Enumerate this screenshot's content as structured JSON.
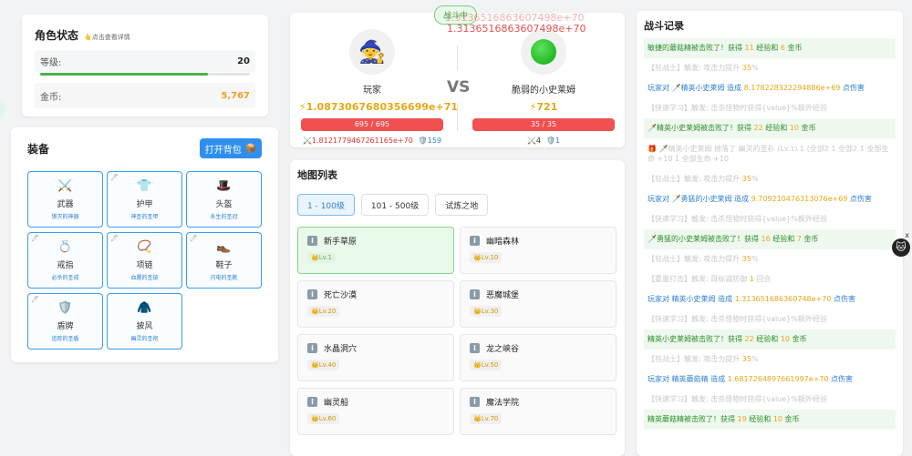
{
  "status": {
    "title": "角色状态",
    "hint": "👆点击查看详情",
    "level_label": "等级:",
    "level_value": "20",
    "level_progress": 0.8,
    "gold_label": "金币:",
    "gold_value": "5,767"
  },
  "equipment": {
    "title": "装备",
    "bag_button": "打开背包",
    "bag_icon": "📦",
    "slots": [
      {
        "icon": "⚔️",
        "name": "武器",
        "sub": "狼灭的神器",
        "edit": false
      },
      {
        "icon": "👕",
        "name": "护甲",
        "sub": "神圣的圣甲",
        "edit": true
      },
      {
        "icon": "🎩",
        "name": "头盔",
        "sub": "永生的圣冠",
        "edit": false
      },
      {
        "icon": "💍",
        "name": "戒指",
        "sub": "必杀的圣戒",
        "edit": true
      },
      {
        "icon": "📿",
        "name": "项链",
        "sub": "血腥的圣链",
        "edit": true
      },
      {
        "icon": "👞",
        "name": "鞋子",
        "sub": "闪电的圣靴",
        "edit": true
      },
      {
        "icon": "🛡️",
        "name": "盾牌",
        "sub": "追踪的圣盾",
        "edit": true
      },
      {
        "icon": "🧥",
        "name": "披风",
        "sub": "幽灵的圣袍",
        "edit": false
      }
    ]
  },
  "battle": {
    "tag": "战斗中",
    "floating_1": "1.3136516863607498e+70",
    "floating_2": "1.3136516863607498e+70",
    "vs": "VS",
    "player": {
      "name": "玩家",
      "avatar": "🧙",
      "power": "⚡1.0873067680356699e+71",
      "hp": "695 / 695",
      "atk": "⚔️1.8121779467261165e+70",
      "def": "🛡️159"
    },
    "enemy": {
      "name": "脆弱的小史莱姆",
      "power": "⚡721",
      "hp": "35 / 35",
      "atk": "⚔️4",
      "def": "🛡️1"
    }
  },
  "maps": {
    "title": "地图列表",
    "tabs": [
      "1 - 100级",
      "101 - 500级",
      "试炼之地"
    ],
    "items": [
      {
        "name": "新手草原",
        "level": "👑Lv.1"
      },
      {
        "name": "幽暗森林",
        "level": "👑Lv.10"
      },
      {
        "name": "死亡沙漠",
        "level": "👑Lv.20"
      },
      {
        "name": "恶魔城堡",
        "level": "👑Lv.30"
      },
      {
        "name": "水晶洞穴",
        "level": "👑Lv.40"
      },
      {
        "name": "龙之峡谷",
        "level": "👑Lv.50"
      },
      {
        "name": "幽灵船",
        "level": "👑Lv.60"
      },
      {
        "name": "魔法学院",
        "level": "👑Lv.70"
      }
    ]
  },
  "log": {
    "title": "战斗记录",
    "lines": [
      {
        "t": "g",
        "parts": [
          "敏捷的蘑菇精被击败了！获得 ",
          "11",
          " 经验和 ",
          "6",
          " 金币"
        ]
      },
      {
        "t": "f",
        "parts": [
          "【狂战士】触发: 攻击力提升 ",
          "35",
          "%"
        ]
      },
      {
        "t": "b",
        "parts": [
          "玩家对 🗡️精英小史莱姆 造成 ",
          "8.178228322294886e+69",
          " 点伤害"
        ]
      },
      {
        "t": "f",
        "parts": [
          "【快速学习】触发: 击杀怪物时获得{value}%额外经验"
        ]
      },
      {
        "t": "g",
        "parts": [
          "🗡️精英小史莱姆被击败了！获得 ",
          "22",
          " 经验和 ",
          "10",
          " 金币"
        ]
      },
      {
        "t": "f2",
        "text": "🎁 🗡️精英小史莱姆 掉落了 幽灵的圣衫 (Lv.1) 1 (全部2 1 全部2 1 全部生命 +10 1 全部生命 +10"
      },
      {
        "t": "f",
        "parts": [
          "【狂战士】触发: 攻击力提升 ",
          "35",
          "%"
        ]
      },
      {
        "t": "b",
        "parts": [
          "玩家对 🗡️勇猛的小史莱姆 造成 ",
          "9.709210476313076e+69",
          " 点伤害"
        ]
      },
      {
        "t": "f",
        "parts": [
          "【快速学习】触发: 击杀怪物时获得{value}%额外经验"
        ]
      },
      {
        "t": "g",
        "parts": [
          "🗡️勇猛的小史莱姆被击败了！获得 ",
          "16",
          " 经验和 ",
          "7",
          " 金币"
        ]
      },
      {
        "t": "f",
        "parts": [
          "【狂战士】触发: 攻击力提升 ",
          "35",
          "%"
        ]
      },
      {
        "t": "f",
        "parts": [
          "【重量打击】触发: 目标减防御 ",
          "1",
          " 回合"
        ]
      },
      {
        "t": "b",
        "parts": [
          "玩家对 精英小史莱姆 造成 ",
          "1.313651686360748e+70",
          " 点伤害"
        ]
      },
      {
        "t": "f",
        "parts": [
          "【快速学习】触发: 击杀怪物时获得{value}%额外经验"
        ]
      },
      {
        "t": "g",
        "parts": [
          "精英小史莱姆被击败了！获得 ",
          "22",
          " 经验和 ",
          "10",
          " 金币"
        ]
      },
      {
        "t": "f",
        "parts": [
          "【狂战士】触发: 攻击力提升 ",
          "35",
          "%"
        ]
      },
      {
        "t": "b",
        "parts": [
          "玩家对 精英蘑菇精 造成 ",
          "1.6817264897661997e+70",
          " 点伤害"
        ]
      },
      {
        "t": "f",
        "parts": [
          "【快速学习】触发: 击杀怪物时获得{value}%额外经验"
        ]
      },
      {
        "t": "g",
        "parts": [
          "精英蘑菇精被击败了！获得 ",
          "19",
          " 经验和 ",
          "10",
          " 金币"
        ]
      }
    ]
  },
  "side": {
    "close": "x",
    "avatar": "🐱"
  },
  "colors": {
    "accent": "#2f8ff0",
    "hp": "#f05050",
    "gold": "#e6a817",
    "success": "#4caf50"
  }
}
